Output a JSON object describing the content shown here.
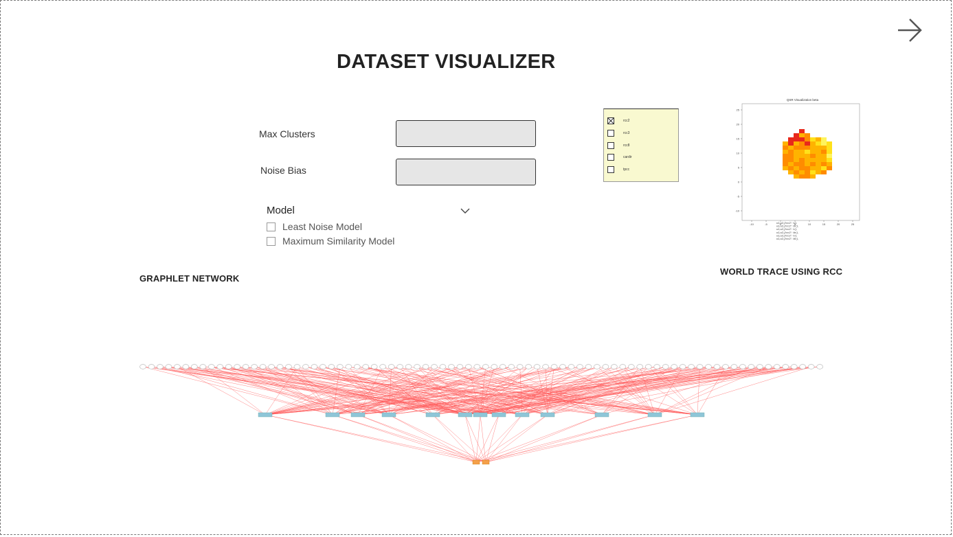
{
  "app": {
    "title": "DATASET VISUALIZER",
    "next_icon": "arrow-right-icon"
  },
  "form": {
    "max_clusters_label": "Max Clusters",
    "max_clusters_value": "",
    "noise_bias_label": "Noise Bias",
    "noise_bias_value": ""
  },
  "model": {
    "label": "Model",
    "dropdown_icon": "chevron-down-icon",
    "options": [
      {
        "label": "Least Noise Model",
        "checked": false
      },
      {
        "label": "Maximum Similarity Model",
        "checked": false
      }
    ]
  },
  "legend": {
    "items": [
      {
        "label": "rcc2",
        "checked": true
      },
      {
        "label": "rcc3",
        "checked": false
      },
      {
        "label": "rcc8",
        "checked": false
      },
      {
        "label": "cardir",
        "checked": false
      },
      {
        "label": "tpcc",
        "checked": false
      }
    ]
  },
  "heatmap": {
    "title": "QSR Visualization beta",
    "xticks": [
      "-10",
      "-5",
      "0",
      "5",
      "10",
      "15",
      "20",
      "25"
    ],
    "yticks": [
      "25",
      "20",
      "15",
      "10",
      "5",
      "0",
      "-5",
      "-10"
    ],
    "legend_lines": [
      "o1,o2,{'rcc2': 'o'},",
      "o1,o2,{'rcc2': 'dc'},",
      "o1,o2,{'rcc2': 'o'},",
      "o1,o2,{'rcc2': 'dc'},",
      "o1,o2,{'rcc2': 'o'},",
      "o1,o2,{'rcc2': 'dc'},"
    ],
    "colors": {
      "red": "#e8281c",
      "orange": "#ff8c00",
      "amber": "#ffb300",
      "yellow": "#ffe11a",
      "pale": "#fff45c"
    }
  },
  "sections": {
    "graphlet_title": "GRAPHLET NETWORK",
    "world_trace_title": "WORLD TRACE USING RCC"
  },
  "network": {
    "edge_color": "#ff5a5a",
    "mid_node_color": "#8fc6d8",
    "bottom_node_color": "#f5a04a"
  }
}
